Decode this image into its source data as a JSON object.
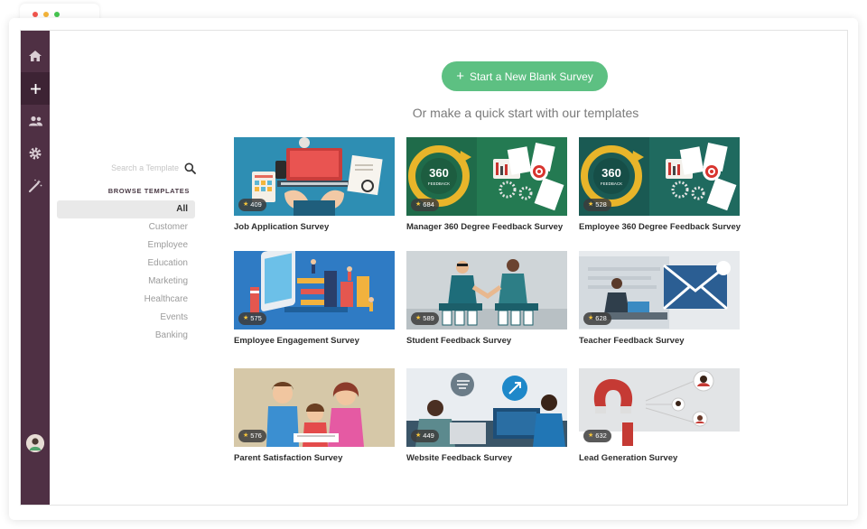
{
  "cta": {
    "plus": "+",
    "label": "Start a New Blank Survey"
  },
  "subheading": "Or make a quick start with our templates",
  "search": {
    "placeholder": "Search a Template"
  },
  "sidebar": {
    "browse_label": "BROWSE TEMPLATES",
    "categories": [
      "All",
      "Customer",
      "Employee",
      "Education",
      "Marketing",
      "Healthcare",
      "Events",
      "Banking"
    ],
    "selected": "All"
  },
  "rail": {
    "items": [
      "home-icon",
      "plus-icon",
      "people-icon",
      "gear-icon",
      "magic-wand-icon"
    ],
    "active": "plus-icon"
  },
  "colors": {
    "rail": "#4f3044",
    "accent": "#5dc082"
  },
  "templates": [
    {
      "title": "Job Application Survey",
      "rating": "409"
    },
    {
      "title": "Manager 360 Degree Feedback Survey",
      "rating": "684",
      "art_text": [
        "360",
        "FEEDBACK"
      ]
    },
    {
      "title": "Employee 360 Degree Feedback Survey",
      "rating": "528",
      "art_text": [
        "360",
        "FEEDBACK"
      ]
    },
    {
      "title": "Employee Engagement Survey",
      "rating": "575"
    },
    {
      "title": "Student Feedback Survey",
      "rating": "589"
    },
    {
      "title": "Teacher Feedback Survey",
      "rating": "628"
    },
    {
      "title": "Parent Satisfaction Survey",
      "rating": "576"
    },
    {
      "title": "Website Feedback Survey",
      "rating": "449"
    },
    {
      "title": "Lead Generation Survey",
      "rating": "632"
    }
  ]
}
